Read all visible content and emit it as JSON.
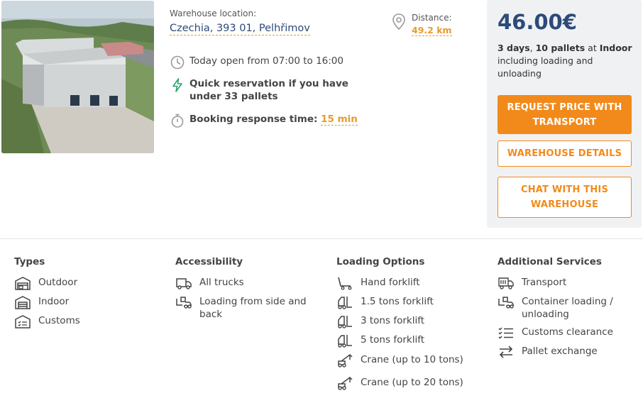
{
  "listing": {
    "location_label": "Warehouse location:",
    "location_value": "Czechia, 393 01, Pelhřimov",
    "opening_hours": "Today open from 07:00 to 16:00",
    "quick_reservation": "Quick reservation if you have under 33 pallets",
    "response_label": "Booking response time:",
    "response_value": "15 min",
    "distance_label": "Distance:",
    "distance_value": "49.2 km"
  },
  "pricing": {
    "price": "46.00€",
    "days": "3 days",
    "sep": ", ",
    "pallets": "10 pallets",
    "at": " at ",
    "type": "Indoor",
    "note": " including loading and unloading",
    "request_button": "REQUEST PRICE WITH TRANSPORT",
    "details_button": "WAREHOUSE DETAILS",
    "chat_button": "CHAT WITH THIS WAREHOUSE"
  },
  "features": {
    "types": {
      "title": "Types",
      "items": [
        {
          "label": "Outdoor",
          "icon": "outdoor-warehouse-icon"
        },
        {
          "label": "Indoor",
          "icon": "indoor-warehouse-icon"
        },
        {
          "label": "Customs",
          "icon": "customs-warehouse-icon"
        }
      ]
    },
    "accessibility": {
      "title": "Accessibility",
      "items": [
        {
          "label": "All trucks",
          "icon": "truck-icon"
        },
        {
          "label": "Loading from side and back",
          "icon": "side-loading-icon"
        }
      ]
    },
    "loading": {
      "title": "Loading Options",
      "items": [
        {
          "label": "Hand forklift",
          "icon": "hand-forklift-icon"
        },
        {
          "label": "1.5 tons forklift",
          "icon": "forklift-icon"
        },
        {
          "label": "3 tons forklift",
          "icon": "forklift-icon"
        },
        {
          "label": "5 tons forklift",
          "icon": "forklift-icon"
        },
        {
          "label": "Crane (up to 10 tons)",
          "icon": "crane-icon"
        },
        {
          "label": "Crane (up to 20 tons)",
          "icon": "crane-icon"
        }
      ]
    },
    "services": {
      "title": "Additional Services",
      "items": [
        {
          "label": "Transport",
          "icon": "transport-truck-icon"
        },
        {
          "label": "Container loading / unloading",
          "icon": "container-loading-icon"
        },
        {
          "label": "Customs clearance",
          "icon": "checklist-icon"
        },
        {
          "label": "Pallet exchange",
          "icon": "exchange-arrows-icon"
        }
      ]
    }
  },
  "colors": {
    "accent": "#f28a1b",
    "brand_blue": "#2c4a7a",
    "success_green": "#2ea36b",
    "panel_bg": "#f0f1f3"
  }
}
